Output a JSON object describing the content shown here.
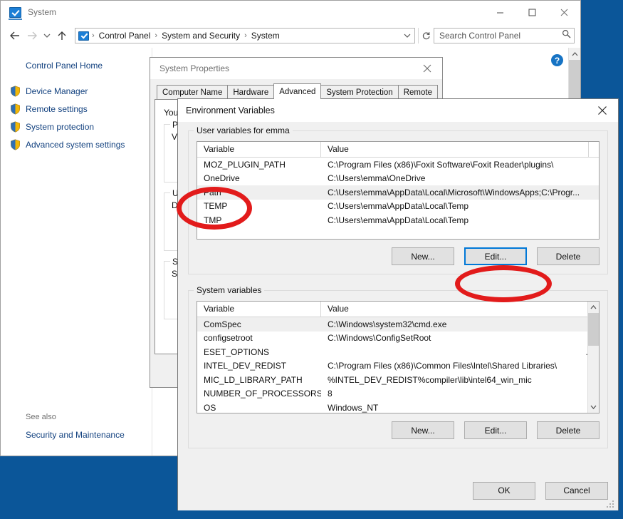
{
  "window": {
    "title": "System",
    "icon": "system-monitor-icon",
    "minimize_label": "Minimize",
    "maximize_label": "Maximize",
    "close_label": "Close"
  },
  "nav": {
    "back_label": "Back",
    "forward_label": "Forward",
    "recent_label": "Recent locations",
    "up_label": "Up",
    "refresh_label": "Refresh",
    "breadcrumbs": [
      "Control Panel",
      "System and Security",
      "System"
    ],
    "separator": "›"
  },
  "search": {
    "placeholder": "Search Control Panel",
    "icon": "search-icon"
  },
  "sidebar": {
    "home": "Control Panel Home",
    "items": [
      {
        "label": "Device Manager",
        "icon": "shield-icon"
      },
      {
        "label": "Remote settings",
        "icon": "shield-icon"
      },
      {
        "label": "System protection",
        "icon": "shield-icon"
      },
      {
        "label": "Advanced system settings",
        "icon": "shield-icon"
      }
    ],
    "see_also_label": "See also",
    "see_also_link": "Security and Maintenance"
  },
  "help": {
    "glyph": "?"
  },
  "system_properties": {
    "title": "System Properties",
    "close_label": "Close",
    "tabs": [
      {
        "label": "Computer Name",
        "active": false
      },
      {
        "label": "Hardware",
        "active": false
      },
      {
        "label": "Advanced",
        "active": true
      },
      {
        "label": "System Protection",
        "active": false
      },
      {
        "label": "Remote",
        "active": false
      }
    ],
    "intro": "You",
    "groups": [
      {
        "label": "Pe",
        "sub": "Vis"
      },
      {
        "label": "Us",
        "sub": "D"
      },
      {
        "label": "Sta",
        "sub": "Sy"
      }
    ]
  },
  "env_dialog": {
    "title": "Environment Variables",
    "close_label": "Close",
    "user_group_label": "User variables for emma",
    "system_group_label": "System variables",
    "columns": [
      "Variable",
      "Value"
    ],
    "user_variables": [
      {
        "name": "MOZ_PLUGIN_PATH",
        "value": "C:\\Program Files (x86)\\Foxit Software\\Foxit Reader\\plugins\\",
        "selected": false
      },
      {
        "name": "OneDrive",
        "value": "C:\\Users\\emma\\OneDrive",
        "selected": false
      },
      {
        "name": "Path",
        "value": "C:\\Users\\emma\\AppData\\Local\\Microsoft\\WindowsApps;C:\\Progr...",
        "selected": true
      },
      {
        "name": "TEMP",
        "value": "C:\\Users\\emma\\AppData\\Local\\Temp",
        "selected": false
      },
      {
        "name": "TMP",
        "value": "C:\\Users\\emma\\AppData\\Local\\Temp",
        "selected": false
      }
    ],
    "system_variables": [
      {
        "name": "ComSpec",
        "value": "C:\\Windows\\system32\\cmd.exe",
        "selected": true,
        "dots": ""
      },
      {
        "name": "configsetroot",
        "value": "C:\\Windows\\ConfigSetRoot",
        "selected": false,
        "dots": ""
      },
      {
        "name": "ESET_OPTIONS",
        "value": "",
        "selected": false,
        "dots": "..."
      },
      {
        "name": "INTEL_DEV_REDIST",
        "value": "C:\\Program Files (x86)\\Common Files\\Intel\\Shared Libraries\\",
        "selected": false,
        "dots": ""
      },
      {
        "name": "MIC_LD_LIBRARY_PATH",
        "value": "%INTEL_DEV_REDIST%compiler\\lib\\intel64_win_mic",
        "selected": false,
        "dots": ""
      },
      {
        "name": "NUMBER_OF_PROCESSORS",
        "value": "8",
        "selected": false,
        "dots": ""
      },
      {
        "name": "OS",
        "value": "Windows_NT",
        "selected": false,
        "dots": ""
      }
    ],
    "user_buttons": {
      "new": "New...",
      "edit": "Edit...",
      "delete": "Delete"
    },
    "system_buttons": {
      "new": "New...",
      "edit": "Edit...",
      "delete": "Delete"
    },
    "footer_buttons": {
      "ok": "OK",
      "cancel": "Cancel"
    },
    "focused_button": "Edit..."
  },
  "annotations": {
    "color": "#e21b1b",
    "marks": [
      {
        "target": "user-variable-path-row",
        "shape": "ellipse"
      },
      {
        "target": "user-edit-button",
        "shape": "ellipse"
      }
    ]
  }
}
